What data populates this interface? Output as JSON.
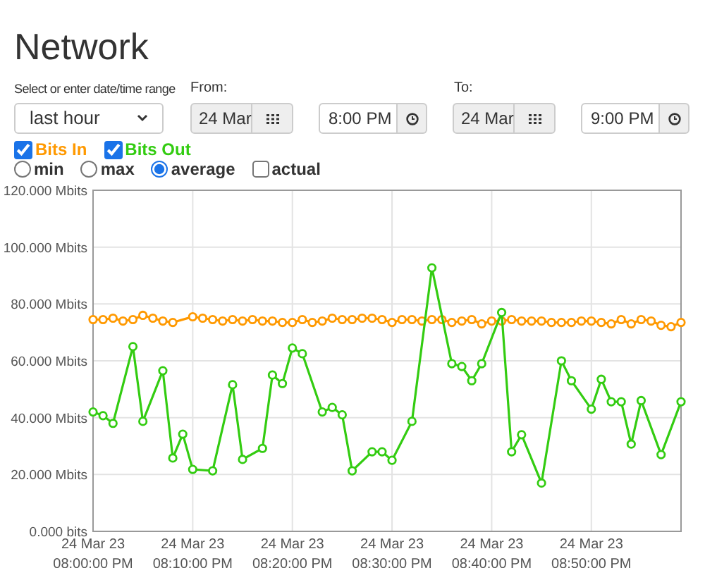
{
  "title": "Network",
  "range": {
    "label": "Select or enter date/time range",
    "value": "last hour"
  },
  "from": {
    "label": "From:",
    "date": "24 Mar",
    "time": "8:00 PM"
  },
  "to": {
    "label": "To:",
    "date": "24 Mar",
    "time": "9:00 PM"
  },
  "series_toggles": [
    {
      "checked": true
    },
    {
      "checked": true
    }
  ],
  "modes": [
    {
      "kind": "radio",
      "label": "min",
      "selected": false
    },
    {
      "kind": "radio",
      "label": "max",
      "selected": false
    },
    {
      "kind": "radio",
      "label": "average",
      "selected": true
    },
    {
      "kind": "checkbox",
      "label": "actual",
      "selected": false
    }
  ],
  "chart_data": {
    "type": "line",
    "grid": true,
    "ylim": [
      0,
      120
    ],
    "categories": [
      "24 Mar 23\n08:00:00 PM",
      null,
      null,
      null,
      null,
      null,
      null,
      null,
      null,
      null,
      "24 Mar 23\n08:10:00 PM",
      null,
      null,
      null,
      null,
      null,
      null,
      null,
      null,
      null,
      "24 Mar 23\n08:20:00 PM",
      null,
      null,
      null,
      null,
      null,
      null,
      null,
      null,
      null,
      "24 Mar 23\n08:30:00 PM",
      null,
      null,
      null,
      null,
      null,
      null,
      null,
      null,
      null,
      "24 Mar 23\n08:40:00 PM",
      null,
      null,
      null,
      null,
      null,
      null,
      null,
      null,
      null,
      "24 Mar 23\n08:50:00 PM",
      null,
      null,
      null,
      null,
      null,
      null,
      null,
      null,
      null
    ],
    "yticks": [
      {
        "value": 0,
        "label": "0.000 bits"
      },
      {
        "value": 20,
        "label": "20.000 Mbits"
      },
      {
        "value": 40,
        "label": "40.000 Mbits"
      },
      {
        "value": 60,
        "label": "60.000 Mbits"
      },
      {
        "value": 80,
        "label": "80.000 Mbits"
      },
      {
        "value": 100,
        "label": "100.000 Mbits"
      },
      {
        "value": 120,
        "label": "120.000 Mbits"
      }
    ],
    "series": [
      {
        "name": "Bits In",
        "color": "#ff9900",
        "marker": "o",
        "values": [
          74.5,
          74.5,
          75,
          74,
          74.5,
          76,
          75,
          74,
          73.5,
          null,
          75.5,
          75,
          74.5,
          74,
          74.5,
          74,
          74.5,
          74,
          74,
          73.5,
          73.5,
          74.5,
          73.5,
          74,
          75,
          74.5,
          74.5,
          75,
          75,
          74.5,
          73.5,
          74.5,
          74.5,
          74,
          74.5,
          74.5,
          73.5,
          74,
          74.5,
          73,
          74,
          74,
          74.5,
          74,
          74,
          74,
          73.5,
          73.5,
          73.5,
          74,
          74,
          73.5,
          73,
          74.5,
          73,
          74.5,
          74,
          72.5,
          72,
          73.5
        ]
      },
      {
        "name": "Bits Out",
        "color": "#33cc11",
        "marker": "o",
        "values": [
          42,
          40.7,
          38,
          null,
          65,
          38.7,
          null,
          56.5,
          25.8,
          34.2,
          21.8,
          null,
          21.3,
          null,
          51.6,
          25.3,
          null,
          29.2,
          55,
          52,
          64.5,
          62.5,
          null,
          42,
          43.6,
          41,
          21.3,
          null,
          28,
          28,
          25,
          null,
          38.7,
          null,
          92.7,
          null,
          59,
          58,
          53,
          59,
          null,
          77,
          28,
          34,
          null,
          17,
          null,
          60,
          53,
          null,
          43,
          53.5,
          45.6,
          45.6,
          30.7,
          46,
          null,
          27,
          null,
          45.6
        ]
      }
    ]
  }
}
